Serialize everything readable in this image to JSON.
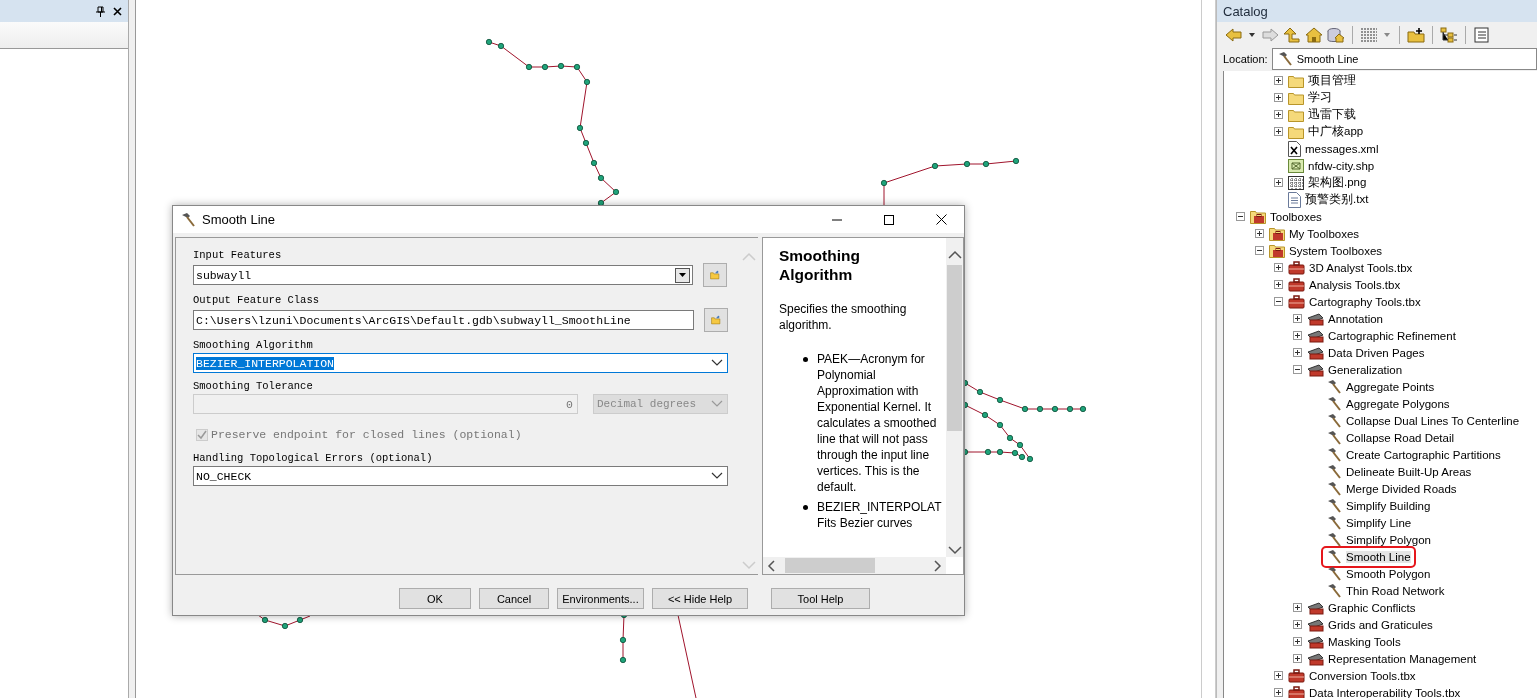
{
  "dialog": {
    "title": "Smooth Line",
    "parameters": [
      {
        "kind": "combo",
        "label": "Input Features",
        "value": "subwayll"
      },
      {
        "kind": "path",
        "label": "Output Feature Class",
        "value": "C:\\Users\\lzuni\\Documents\\ArcGIS\\Default.gdb\\subwayll_SmoothLine"
      },
      {
        "kind": "select",
        "label": "Smoothing Algorithm",
        "value": "BEZIER_INTERPOLATION",
        "focused": true
      },
      {
        "kind": "number",
        "label": "Smoothing Tolerance",
        "value": "0",
        "unit": "Decimal degrees",
        "disabled": true
      },
      {
        "kind": "checkbox",
        "label": "Preserve endpoint for closed lines (optional)",
        "checked": true,
        "disabled": true
      },
      {
        "kind": "select",
        "label": "Handling Topological Errors (optional)",
        "value": "NO_CHECK",
        "focused": false
      }
    ],
    "help": {
      "heading": "Smoothing Algorithm",
      "intro": "Specifies the smoothing algorithm.",
      "bullets": [
        "PAEK—Acronym for Polynomial Approximation with Exponential Kernel. It calculates a smoothed line that will not pass through the input line vertices. This is the default.",
        "BEZIER_INTERPOLAT Fits Bezier curves"
      ]
    },
    "buttons": [
      "OK",
      "Cancel",
      "Environments...",
      "<< Hide Help",
      "Tool Help"
    ]
  },
  "catalog": {
    "title": "Catalog",
    "location_label": "Location:",
    "location": "Smooth Line",
    "folder_items": [
      {
        "label": "项目管理",
        "kind": "folder",
        "expanded": false,
        "selected": false
      },
      {
        "label": "学习",
        "kind": "folder",
        "expanded": false,
        "selected": false
      },
      {
        "label": "迅雷下载",
        "kind": "folder",
        "expanded": false,
        "selected": false
      },
      {
        "label": "中广核app",
        "kind": "folder",
        "expanded": false,
        "selected": false
      },
      {
        "label": "messages.xml",
        "kind": "xml",
        "selected": false
      },
      {
        "label": "nfdw-city.shp",
        "kind": "shp",
        "selected": false
      },
      {
        "label": "架构图.png",
        "kind": "png",
        "expanded": false,
        "selected": false
      },
      {
        "label": "预警类别.txt",
        "kind": "txt",
        "selected": false
      }
    ],
    "tree": [
      {
        "label": "Toolboxes",
        "kind": "toolboxes",
        "expanded": true,
        "selected": false,
        "children": [
          {
            "label": "My Toolboxes",
            "kind": "toolboxes",
            "expanded": false,
            "selected": false
          },
          {
            "label": "System Toolboxes",
            "kind": "toolboxes",
            "expanded": true,
            "selected": false,
            "children": [
              {
                "label": "3D Analyst Tools.tbx",
                "kind": "toolbox",
                "expanded": false,
                "selected": false
              },
              {
                "label": "Analysis Tools.tbx",
                "kind": "toolbox",
                "expanded": false,
                "selected": false
              },
              {
                "label": "Cartography Tools.tbx",
                "kind": "toolbox",
                "expanded": true,
                "selected": false,
                "children": [
                  {
                    "label": "Annotation",
                    "kind": "toolset",
                    "expanded": false,
                    "selected": false
                  },
                  {
                    "label": "Cartographic Refinement",
                    "kind": "toolset",
                    "expanded": false,
                    "selected": false
                  },
                  {
                    "label": "Data Driven Pages",
                    "kind": "toolset",
                    "expanded": false,
                    "selected": false
                  },
                  {
                    "label": "Generalization",
                    "kind": "toolset",
                    "expanded": true,
                    "selected": false,
                    "children": [
                      {
                        "label": "Aggregate Points",
                        "kind": "tool",
                        "selected": false
                      },
                      {
                        "label": "Aggregate Polygons",
                        "kind": "tool",
                        "selected": false
                      },
                      {
                        "label": "Collapse Dual Lines To Centerline",
                        "kind": "tool",
                        "selected": false
                      },
                      {
                        "label": "Collapse Road Detail",
                        "kind": "tool",
                        "selected": false
                      },
                      {
                        "label": "Create Cartographic Partitions",
                        "kind": "tool",
                        "selected": false
                      },
                      {
                        "label": "Delineate Built-Up Areas",
                        "kind": "tool",
                        "selected": false
                      },
                      {
                        "label": "Merge Divided Roads",
                        "kind": "tool",
                        "selected": false
                      },
                      {
                        "label": "Simplify Building",
                        "kind": "tool",
                        "selected": false
                      },
                      {
                        "label": "Simplify Line",
                        "kind": "tool",
                        "selected": false
                      },
                      {
                        "label": "Simplify Polygon",
                        "kind": "tool",
                        "selected": false
                      },
                      {
                        "label": "Smooth Line",
                        "kind": "tool",
                        "selected": true
                      },
                      {
                        "label": "Smooth Polygon",
                        "kind": "tool",
                        "selected": false
                      },
                      {
                        "label": "Thin Road Network",
                        "kind": "tool",
                        "selected": false
                      }
                    ]
                  },
                  {
                    "label": "Graphic Conflicts",
                    "kind": "toolset",
                    "expanded": false,
                    "selected": false
                  },
                  {
                    "label": "Grids and Graticules",
                    "kind": "toolset",
                    "expanded": false,
                    "selected": false
                  },
                  {
                    "label": "Masking Tools",
                    "kind": "toolset",
                    "expanded": false,
                    "selected": false
                  },
                  {
                    "label": "Representation Management",
                    "kind": "toolset",
                    "expanded": false,
                    "selected": false
                  }
                ]
              },
              {
                "label": "Conversion Tools.tbx",
                "kind": "toolbox",
                "expanded": false,
                "selected": false
              },
              {
                "label": "Data Interoperability Tools.tbx",
                "kind": "toolbox",
                "expanded": false,
                "selected": false
              }
            ]
          }
        ]
      }
    ]
  }
}
